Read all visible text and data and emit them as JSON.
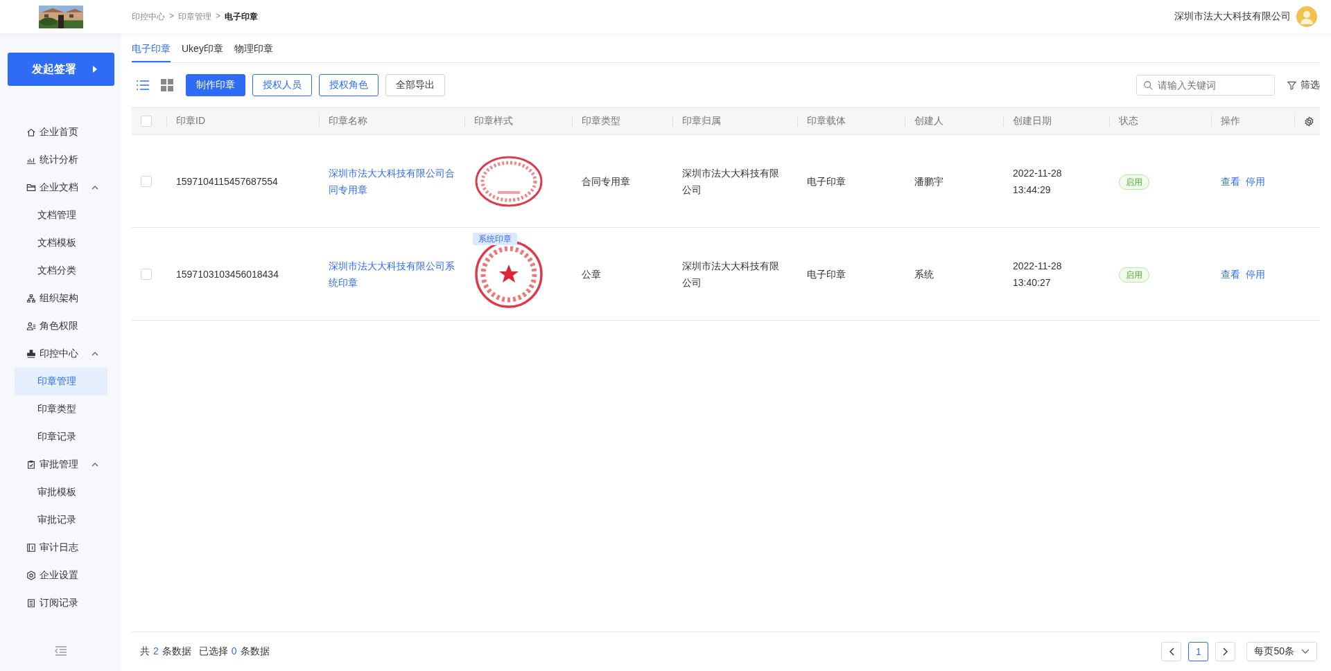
{
  "header": {
    "breadcrumb": [
      {
        "label": "印控中心",
        "current": false
      },
      {
        "label": ">",
        "current": false
      },
      {
        "label": "印章管理",
        "current": false
      },
      {
        "label": ">",
        "current": false
      },
      {
        "label": "电子印章",
        "current": true
      }
    ],
    "company": "深圳市法大大科技有限公司"
  },
  "sidebar": {
    "start_button": "发起签署",
    "items": [
      {
        "label": "企业首页",
        "selected": false
      },
      {
        "label": "统计分析",
        "selected": false
      },
      {
        "label": "企业文档",
        "selected": false,
        "expanded": true,
        "children": [
          {
            "label": "文档管理",
            "selected": false
          },
          {
            "label": "文档模板",
            "selected": false
          },
          {
            "label": "文档分类",
            "selected": false
          }
        ]
      },
      {
        "label": "组织架构",
        "selected": false
      },
      {
        "label": "角色权限",
        "selected": false
      },
      {
        "label": "印控中心",
        "selected": false,
        "expanded": true,
        "children": [
          {
            "label": "印章管理",
            "selected": true
          },
          {
            "label": "印章类型",
            "selected": false
          },
          {
            "label": "印章记录",
            "selected": false
          }
        ]
      },
      {
        "label": "审批管理",
        "selected": false,
        "expanded": true,
        "children": [
          {
            "label": "审批模板",
            "selected": false
          },
          {
            "label": "审批记录",
            "selected": false
          }
        ]
      },
      {
        "label": "审计日志",
        "selected": false
      },
      {
        "label": "企业设置",
        "selected": false
      },
      {
        "label": "订阅记录",
        "selected": false
      }
    ]
  },
  "tabs": [
    {
      "label": "电子印章",
      "selected": true
    },
    {
      "label": "Ukey印章",
      "selected": false
    },
    {
      "label": "物理印章",
      "selected": false
    }
  ],
  "toolbar": {
    "views": [
      {
        "kind": "list",
        "selected": true
      },
      {
        "kind": "grid",
        "selected": false
      }
    ],
    "buttons": [
      {
        "label": "制作印章",
        "kind": "primary"
      },
      {
        "label": "授权人员",
        "kind": "outline"
      },
      {
        "label": "授权角色",
        "kind": "outline"
      },
      {
        "label": "全部导出",
        "kind": "plain"
      }
    ],
    "search": {
      "placeholder": "请输入关键词"
    },
    "filter": "筛选"
  },
  "table": {
    "all_checked": false,
    "columns": [
      "印章ID",
      "印章名称",
      "印章样式",
      "印章类型",
      "印章归属",
      "印章载体",
      "创建人",
      "创建日期",
      "状态",
      "操作"
    ],
    "rows": [
      {
        "checked": false,
        "id": "1597104115457687554",
        "name": "深圳市法大大科技有限公司合同专用章",
        "seal": {
          "kind": "oval"
        },
        "type": "合同专用章",
        "owner": "深圳市法大大科技有限公司",
        "carrier": "电子印章",
        "creator": "潘鹏宇",
        "date": "2022-11-28",
        "time": "13:44:29",
        "status": {
          "label": "启用",
          "on": true
        },
        "actions": [
          "查看",
          "停用"
        ]
      },
      {
        "checked": false,
        "id": "1597103103456018434",
        "name": "深圳市法大大科技有限公司系统印章",
        "seal": {
          "kind": "round",
          "badge": "系统印章"
        },
        "type": "公章",
        "owner": "深圳市法大大科技有限公司",
        "carrier": "电子印章",
        "creator": "系统",
        "date": "2022-11-28",
        "time": "13:40:27",
        "status": {
          "label": "启用",
          "on": true
        },
        "actions": [
          "查看",
          "停用"
        ]
      }
    ]
  },
  "footer": {
    "total_label": "共",
    "total": "2",
    "total_unit": "条数据",
    "selected_label": "已选择",
    "selected": "0",
    "selected_unit": "条数据",
    "pages": [
      {
        "label": "1",
        "selected": true
      }
    ],
    "page_size": "每页50条"
  }
}
